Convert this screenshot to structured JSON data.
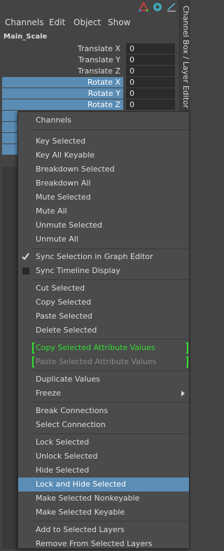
{
  "menubar": {
    "items": [
      "Channels",
      "Edit",
      "Object",
      "Show"
    ]
  },
  "top_icons": [
    "tri-color-icon",
    "circle-symbol-icon",
    "graph-arrow-icon"
  ],
  "side_tab": {
    "label": "Channel Box / Layer Editor"
  },
  "object_name": "Main_Scale",
  "attributes": [
    {
      "label": "Translate X",
      "value": "0",
      "highlighted": false
    },
    {
      "label": "Translate Y",
      "value": "0",
      "highlighted": false
    },
    {
      "label": "Translate Z",
      "value": "0",
      "highlighted": false
    },
    {
      "label": "Rotate X",
      "value": "0",
      "highlighted": true
    },
    {
      "label": "Rotate Y",
      "value": "0",
      "highlighted": true
    },
    {
      "label": "Rotate Z",
      "value": "0",
      "highlighted": true
    }
  ],
  "colors": {
    "highlight": "#5a8cb4",
    "selected_menu": "#5b8db5",
    "green_text": "#33dd33",
    "background": "#444444"
  },
  "popup": {
    "header": "Channels",
    "groups": [
      [
        "Key Selected",
        "Key All Keyable",
        "Breakdown Selected",
        "Breakdown All",
        "Mute Selected",
        "Mute All",
        "Unmute Selected",
        "Unmute All"
      ],
      [
        "Sync Selection in Graph Editor",
        "Sync Timeline Display"
      ],
      [
        "Cut Selected",
        "Copy Selected",
        "Paste Selected",
        "Delete Selected"
      ],
      [
        "Copy Selected Attribute Values",
        "Paste Selected Attribute Values"
      ],
      [
        "Duplicate Values",
        "Freeze"
      ],
      [
        "Break Connections",
        "Select Connection"
      ],
      [
        "Lock Selected",
        "Unlock Selected",
        "Hide Selected",
        "Lock and Hide Selected",
        "Make Selected Nonkeyable",
        "Make Selected Keyable"
      ],
      [
        "Add to Selected Layers",
        "Remove From Selected Layers"
      ]
    ],
    "selected_item": "Lock and Hide Selected"
  }
}
